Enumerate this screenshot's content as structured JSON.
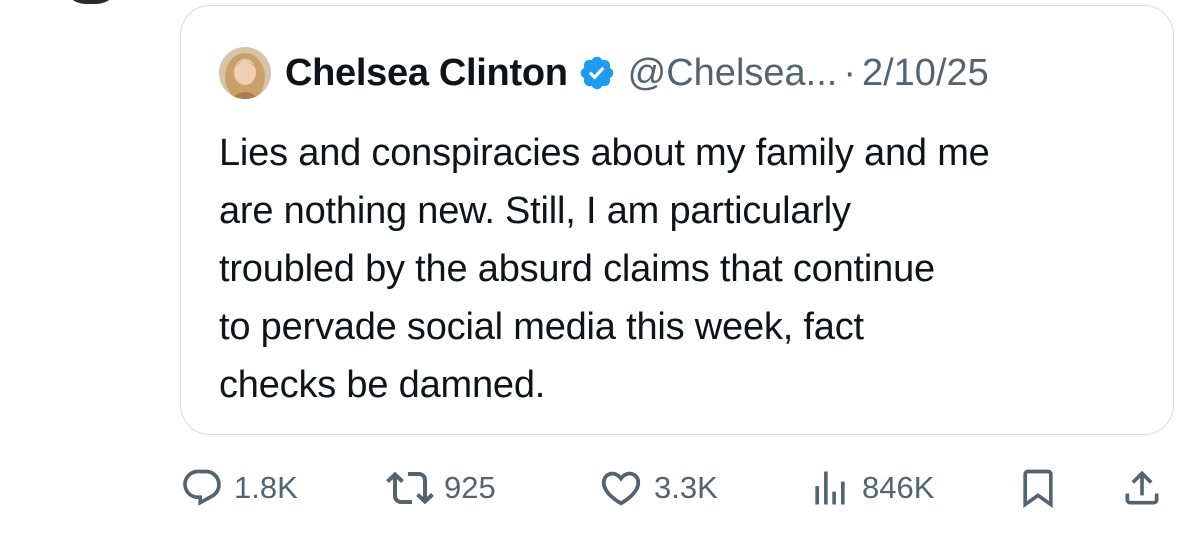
{
  "quote": {
    "author_name": "Chelsea Clinton",
    "handle": "@Chelsea...",
    "separator": "·",
    "date": "2/10/25",
    "text": "Lies and conspiracies about my family and me are nothing new. Still, I am particularly troubled by the absurd claims that continue to pervade social media this week, fact checks be damned.",
    "text_lines": [
      "Lies and conspiracies about my family and me",
      "are nothing new. Still, I am particularly",
      "troubled by the absurd claims that continue",
      "to pervade social media this week, fact",
      "checks be damned."
    ]
  },
  "actions": {
    "replies": "1.8K",
    "reposts": "925",
    "likes": "3.3K",
    "views": "846K"
  },
  "icons": {
    "reply": "reply-icon",
    "repost": "repost-icon",
    "like": "heart-icon",
    "views": "views-chart-icon",
    "bookmark": "bookmark-icon",
    "share": "share-icon",
    "verified": "verified-badge-icon"
  },
  "colors": {
    "text": "#0f1419",
    "secondary": "#536471",
    "verified": "#1d9bf0",
    "border": "#d6dbe0"
  }
}
